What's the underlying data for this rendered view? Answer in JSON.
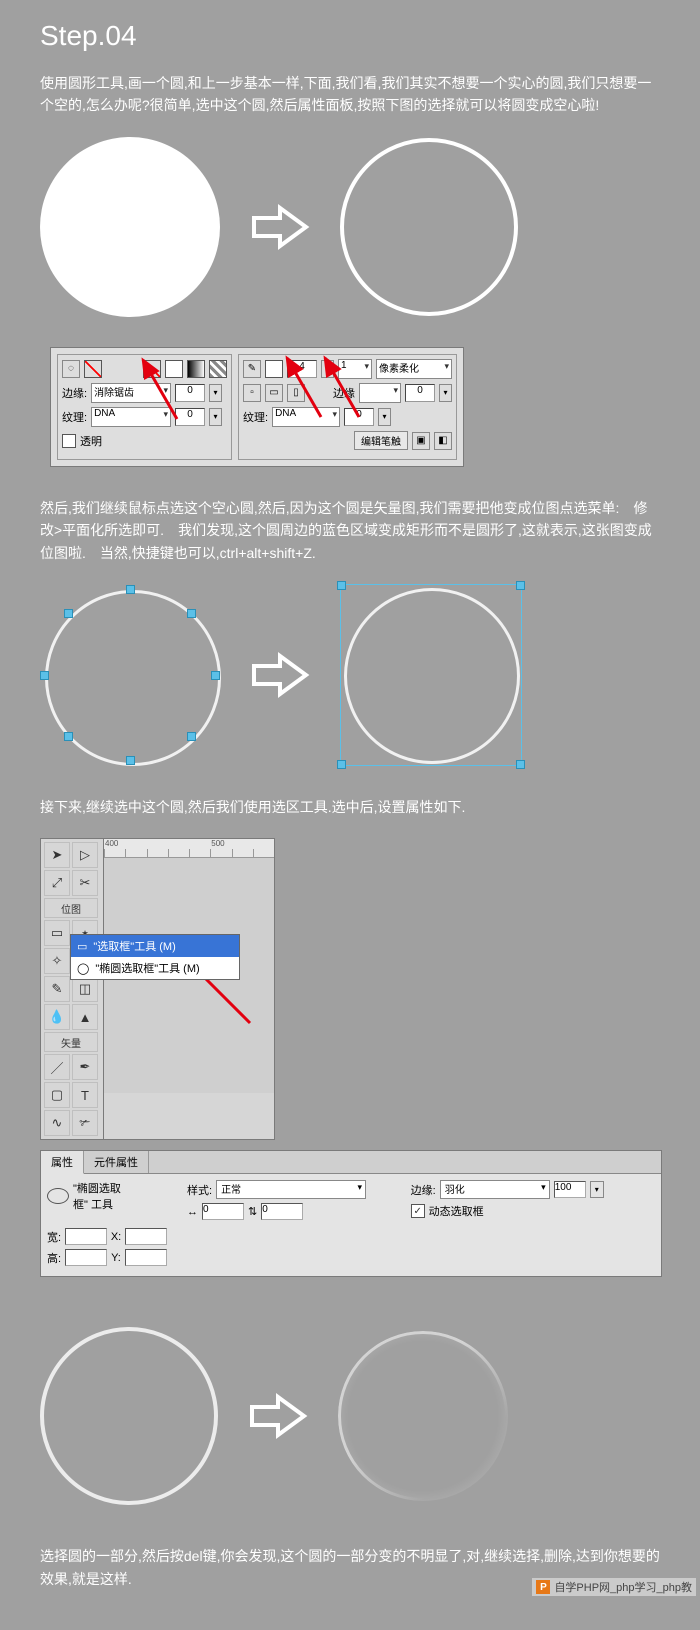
{
  "step_title": "Step.04",
  "intro_text": "使用圆形工具,画一个圆,和上一步基本一样,下面,我们看,我们其实不想要一个实心的圆,我们只想要一个空的,怎么办呢?很简单,选中这个圆,然后属性面板,按照下图的选择就可以将圆变成空心啦!",
  "panel1": {
    "edge_label": "边缘:",
    "edge_value": "消除锯齿",
    "texture_label": "纹理:",
    "texture_value": "DNA",
    "texture_num": "0",
    "transparent_label": "透明",
    "stroke_width": "4",
    "stroke_edge_label": "边缘",
    "stroke_edge_val": "0",
    "stroke_type": "1",
    "stroke_kind": "像素柔化",
    "right_texture_label": "纹理:",
    "right_texture_value": "DNA",
    "right_texture_num": "0",
    "edit_brush_label": "编辑笔触"
  },
  "mid_text": "然后,我们继续鼠标点选这个空心圆,然后,因为这个圆是矢量图,我们需要把他变成位图点选菜单:　修改>平面化所选即可.　我们发现,这个圆周边的蓝色区域变成矩形而不是圆形了,这就表示,这张图变成位图啦.　当然,快捷键也可以,ctrl+alt+shift+Z.",
  "sel_text": "接下来,继续选中这个圆,然后我们使用选区工具.选中后,设置属性如下.",
  "toolbox": {
    "section_label": "位图",
    "vector_label": "矢量",
    "ruler_marks": [
      "400",
      "500"
    ],
    "flyout_item1": "\"选取框\"工具 (M)",
    "flyout_item2": "\"椭圆选取框\"工具 (M)"
  },
  "panel2": {
    "tab1": "属性",
    "tab2": "元件属性",
    "tool_name_l1": "\"椭圆选取",
    "tool_name_l2": "框\" 工具",
    "style_label": "样式:",
    "style_value": "正常",
    "arrows_lr": "↔",
    "arrows_lr_val": "0",
    "lock_icon": "⇅",
    "lock_val": "0",
    "edge_label": "边缘:",
    "edge_value": "羽化",
    "edge_num": "100",
    "dyn_check": "✓",
    "dyn_label": "动态选取框",
    "w_label": "宽:",
    "h_label": "高:",
    "x_label": "X:",
    "y_label": "Y:"
  },
  "final_text": "选择圆的一部分,然后按del键,你会发现,这个圆的一部分变的不明显了,对,继续选择,删除,达到你想要的效果,就是这样.",
  "watermark": "自学PHP网_php学习_php教"
}
